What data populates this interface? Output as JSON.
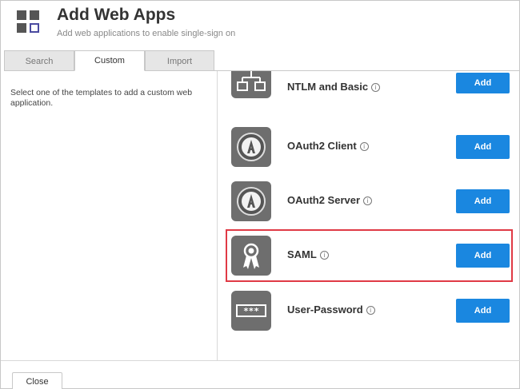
{
  "header": {
    "title": "Add Web Apps",
    "subtitle": "Add web applications to enable single-sign on",
    "icon": "grid-apps-icon"
  },
  "tabs": [
    {
      "label": "Search",
      "active": false
    },
    {
      "label": "Custom",
      "active": true
    },
    {
      "label": "Import",
      "active": false
    }
  ],
  "left_pane": {
    "instructions": "Select one of the templates to add a custom web application."
  },
  "templates": [
    {
      "name": "NTLM and Basic",
      "icon": "network-icon",
      "button": "Add"
    },
    {
      "name": "OAuth2 Client",
      "icon": "oauth-icon",
      "button": "Add"
    },
    {
      "name": "OAuth2 Server",
      "icon": "oauth-icon",
      "button": "Add"
    },
    {
      "name": "SAML",
      "icon": "ribbon-award-icon",
      "button": "Add",
      "highlighted": true
    },
    {
      "name": "User-Password",
      "icon": "password-field-icon",
      "button": "Add"
    }
  ],
  "info_glyph": "i",
  "password_glyph": "***",
  "footer": {
    "close_label": "Close"
  },
  "colors": {
    "primary_button": "#1a87e0",
    "highlight_border": "#e03a45",
    "tile": "#6e6e6e"
  }
}
